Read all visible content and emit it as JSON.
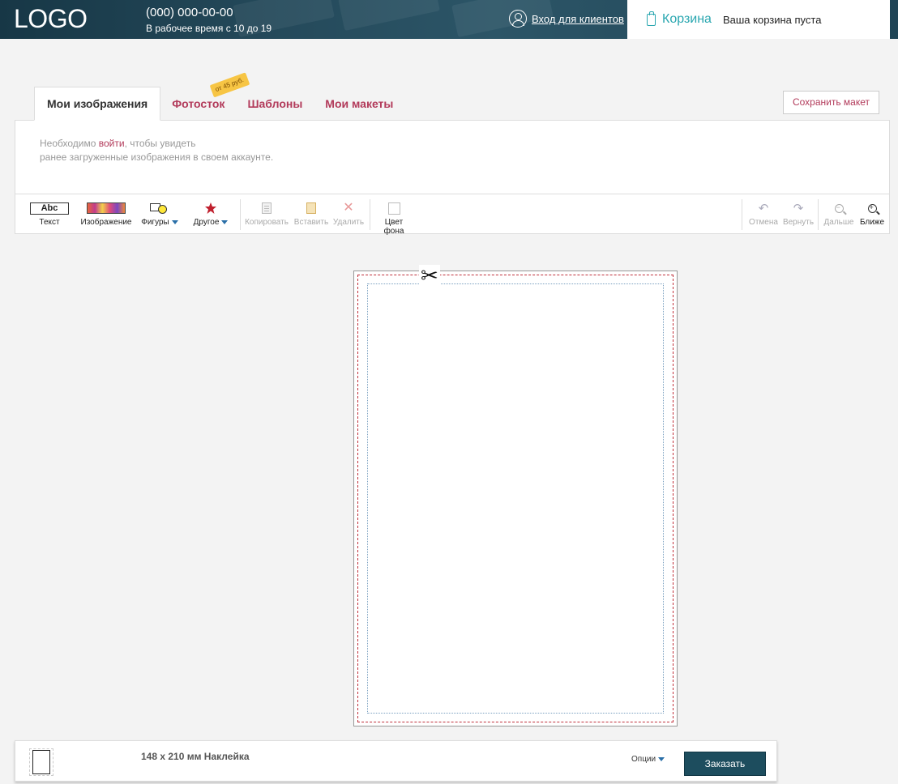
{
  "header": {
    "logo": "LOGO",
    "phone": "(000) 000-00-00",
    "hours": "В рабочее время с 10 до 19",
    "login_label": "Вход для клиентов",
    "cart_title": "Корзина",
    "cart_status": "Ваша корзина пуста"
  },
  "tabs": [
    {
      "label": "Мои изображения",
      "active": true
    },
    {
      "label": "Фотосток",
      "badge": "от 45 руб."
    },
    {
      "label": "Шаблоны"
    },
    {
      "label": "Мои макеты"
    }
  ],
  "save_label": "Сохранить макет",
  "images_panel": {
    "prefix": "Необходимо ",
    "link": "войти",
    "suffix": ", чтобы увидеть",
    "line2": "ранее загруженные изображения в своем аккаунте."
  },
  "toolbar": {
    "text_icon": "Abc",
    "text": "Текст",
    "image": "Изображение",
    "shapes": "Фигуры",
    "other": "Другое",
    "copy": "Копировать",
    "paste": "Вставить",
    "delete": "Удалить",
    "bg_color": "Цвет фона",
    "undo": "Отмена",
    "redo": "Вернуть",
    "zoom_out": "Дальше",
    "zoom_in": "Ближе"
  },
  "bottom": {
    "product": "148 x 210 мм Наклейка",
    "options": "Опции",
    "order": "Заказать"
  },
  "colors": {
    "header_bg": "#1f4252",
    "accent": "#b23a5a",
    "cart_accent": "#2aa7b0",
    "order_button": "#1d4d5e"
  },
  "icons": [
    "user-icon",
    "clipboard-icon",
    "star-icon",
    "scissors-icon",
    "undo-icon",
    "redo-icon",
    "zoom-out-icon",
    "zoom-in-icon"
  ]
}
